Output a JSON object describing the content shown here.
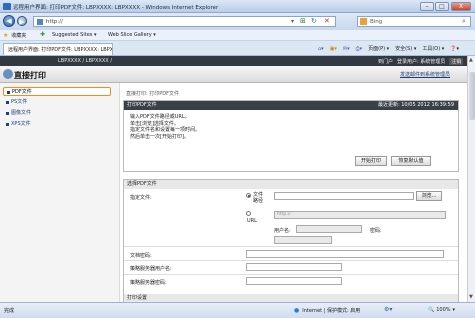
{
  "window": {
    "title": "远程用户界面: 打印PDF文件: LBPXXXX: LBPXXXX - Windows Internet Explorer",
    "min_icon": "minimize-icon",
    "max_icon": "maximize-icon",
    "close_label": "X"
  },
  "address": {
    "url": "http://",
    "search_value": "Bing"
  },
  "favorites": {
    "label": "收藏夹",
    "items": [
      "Suggested Sites ▾",
      "Web Slice Gallery ▾"
    ]
  },
  "tab": {
    "label": "远程用户界面: 打印PDF文件: LBPXXXX: LBPXXXX"
  },
  "commandbar": {
    "page": "页面(P) ▾",
    "safety": "安全(S) ▾",
    "tools": "工具(O) ▾",
    "help": "❓▾"
  },
  "device": {
    "name": "LBPXXXX / LBPXXXX /",
    "links": [
      "到门户",
      "登录用户: 系统管理员",
      "注销"
    ],
    "support_link": "发送邮件到系统管理员"
  },
  "brand": {
    "title": "直接打印"
  },
  "sidebar": {
    "items": [
      {
        "label": "PDF文件",
        "selected": true
      },
      {
        "label": "PS文件",
        "selected": false
      },
      {
        "label": "图像文件",
        "selected": false
      },
      {
        "label": "XPS文件",
        "selected": false
      }
    ]
  },
  "breadcrumb": "直接打印: 打印PDF文件",
  "panel1": {
    "title": "打印PDF文件",
    "updated": "最近更新: 10/05 2012 16:39:59",
    "instructions": [
      "输入PDF文件路径或URL。",
      "单击[浏览]选择文件。",
      "指定文件名和设置每一项时间。",
      "然后单击一次[开始打印]。"
    ],
    "start_button": "开始打印",
    "default_button": "恢复默认值"
  },
  "panel2": {
    "title": "选择PDF文件",
    "file_label": "指定文件:",
    "option_path": "文件路径",
    "option_url": "URL",
    "browse_button": "浏览...",
    "url_value": "http://",
    "username_label": "用户名:",
    "password_label": "密码:",
    "doc_password_label": "文档密码:",
    "policy_user_label": "策略服务器用户名:",
    "policy_password_label": "策略服务器密码:",
    "next_section": "打印设置"
  },
  "status": {
    "left": "完成",
    "zone": "Internet | 保护模式: 启用",
    "zoom": "100%"
  }
}
